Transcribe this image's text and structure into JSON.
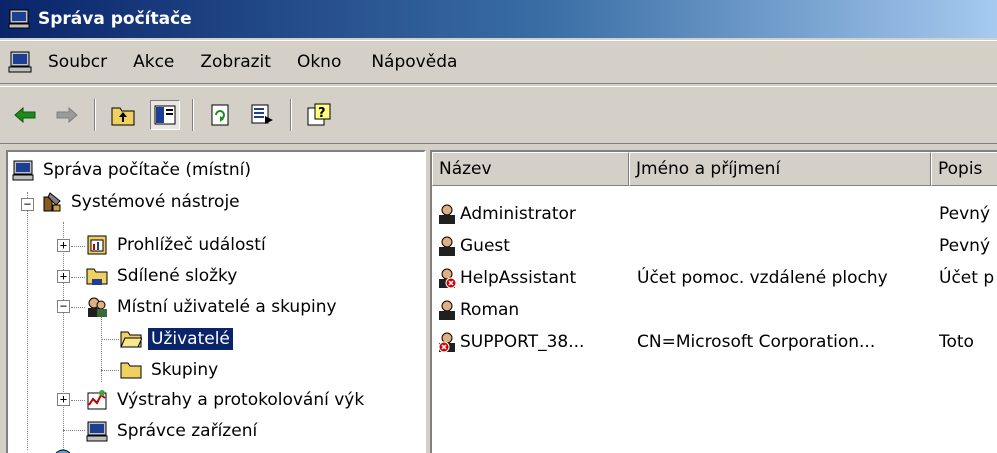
{
  "window": {
    "title": "Správa počítače"
  },
  "menu": {
    "items": [
      "Soubcr",
      "Akce",
      "Zobrazit",
      "Okno",
      "Nápověda"
    ]
  },
  "toolbar": {
    "buttons": [
      "back-arrow-icon",
      "forward-arrow-icon",
      "up-folder-icon",
      "show-tree-icon",
      "refresh-icon",
      "export-list-icon",
      "help-icon"
    ]
  },
  "tree": {
    "root": "Správa počítače (místní)",
    "system_tools": "Systémové nástroje",
    "event_viewer": "Prohlížeč událostí",
    "shared_folders": "Sdílené složky",
    "local_users": "Místní uživatelé a skupiny",
    "users": "Uživatelé",
    "groups": "Skupiny",
    "alerts": "Výstrahy a protokolování výk",
    "device_manager": "Správce zařízení"
  },
  "list": {
    "columns": [
      "Název",
      "Jméno a příjmení",
      "Popis"
    ],
    "rows": [
      {
        "name": "Administrator",
        "full_name": "",
        "description": "Pevný",
        "disabled": false
      },
      {
        "name": "Guest",
        "full_name": "",
        "description": "Pevný",
        "disabled": false
      },
      {
        "name": "HelpAssistant",
        "full_name": "Účet pomoc. vzdálené plochy",
        "description": "Účet p",
        "disabled": true
      },
      {
        "name": "Roman",
        "full_name": "",
        "description": "",
        "disabled": false
      },
      {
        "name": "SUPPORT_38...",
        "full_name": "CN=Microsoft Corporation...",
        "description": "Toto",
        "disabled": true
      }
    ]
  },
  "colors": {
    "title_active": "#0a246a",
    "selection": "#0a246a",
    "face": "#d4d0c8"
  }
}
